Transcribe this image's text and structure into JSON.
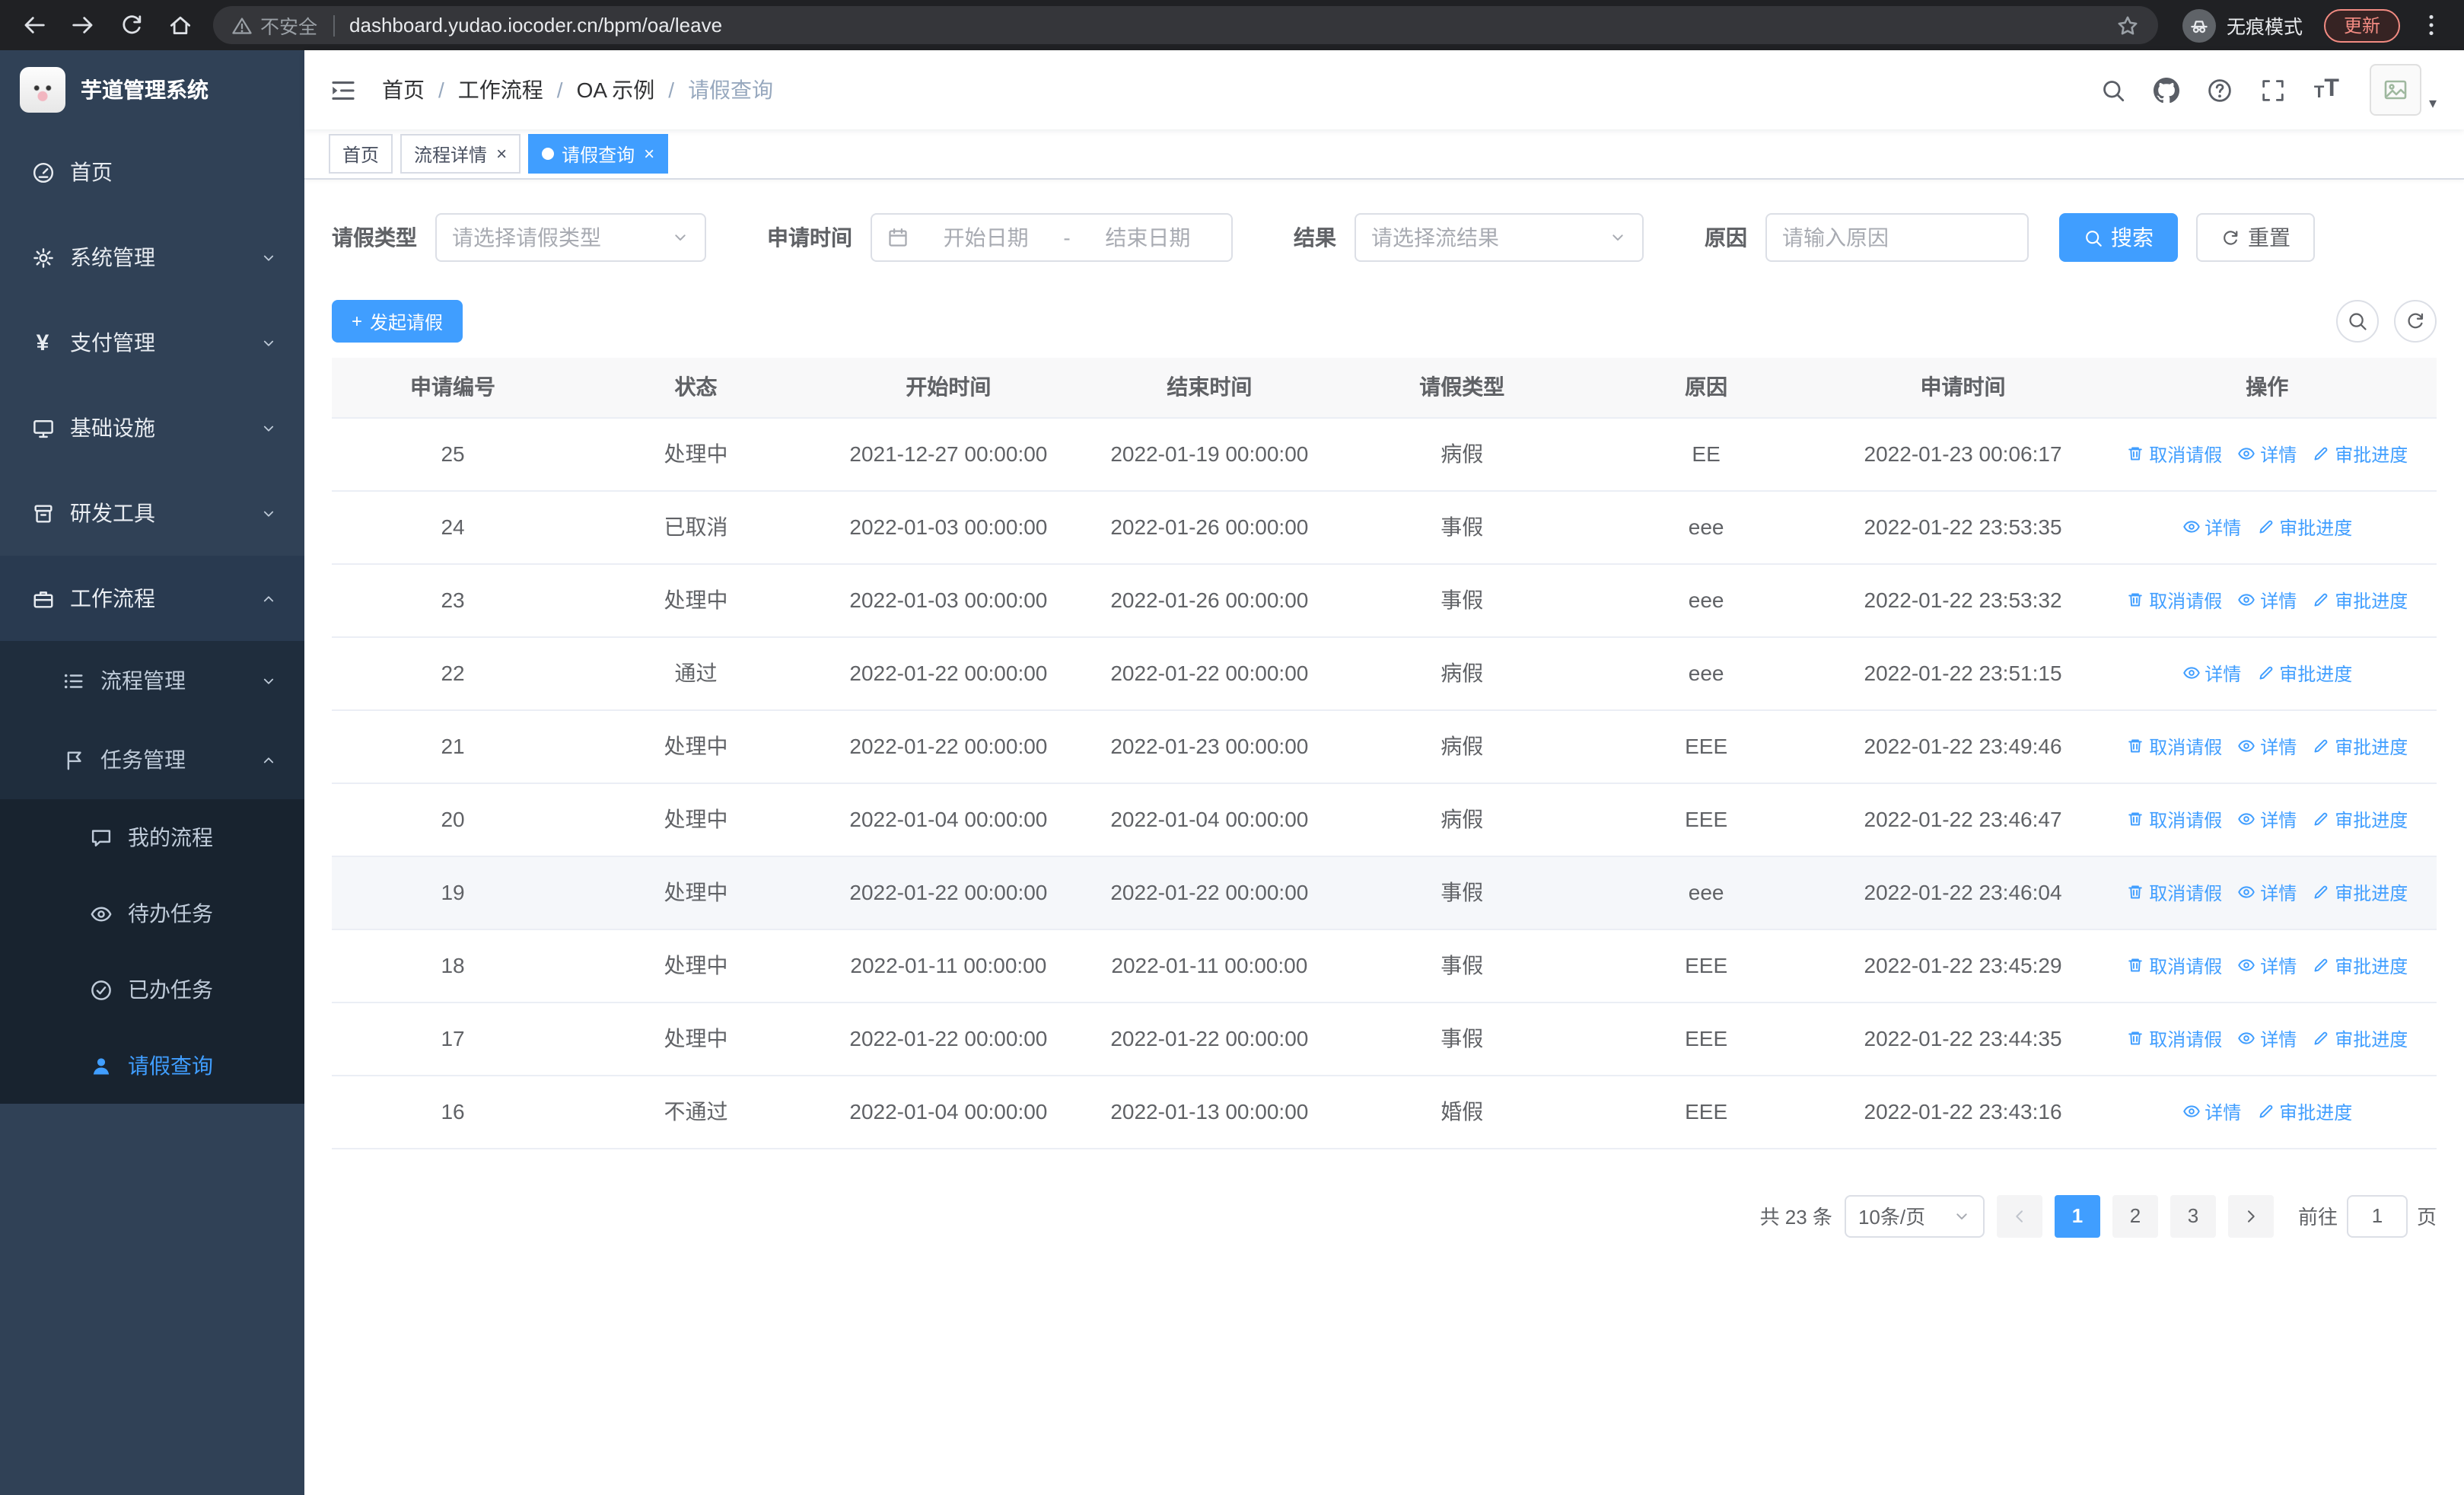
{
  "colors": {
    "accent": "#409eff",
    "sidebar_bg": "#304156",
    "sidebar_sub_bg": "#1f2d3d",
    "sidebar_sub2_bg": "#18232f",
    "browser_bar_bg": "#202124",
    "table_header_bg": "#f8f8f9"
  },
  "browser": {
    "nav_icons": [
      "back-icon",
      "forward-icon",
      "reload-icon",
      "home-icon"
    ],
    "security_warning": "不安全",
    "url": "dashboard.yudao.iocoder.cn/bpm/oa/leave",
    "incognito_label": "无痕模式",
    "update_button": "更新"
  },
  "sidebar": {
    "logo_title": "芋道管理系统",
    "menu": [
      {
        "key": "home",
        "label": "首页",
        "icon": "dashboard-icon",
        "level": 1
      },
      {
        "key": "system",
        "label": "系统管理",
        "icon": "gear-icon",
        "level": 1,
        "chevron": "down"
      },
      {
        "key": "payment",
        "label": "支付管理",
        "icon": "yen-icon",
        "level": 1,
        "chevron": "down"
      },
      {
        "key": "infra",
        "label": "基础设施",
        "icon": "monitor-icon",
        "level": 1,
        "chevron": "down"
      },
      {
        "key": "devtools",
        "label": "研发工具",
        "icon": "toolbox-icon",
        "level": 1,
        "chevron": "down"
      },
      {
        "key": "workflow",
        "label": "工作流程",
        "icon": "briefcase-icon",
        "level": 1,
        "chevron": "up",
        "expanded": true
      },
      {
        "key": "process-mgmt",
        "label": "流程管理",
        "icon": "list-icon",
        "level": 2,
        "chevron": "down"
      },
      {
        "key": "task-mgmt",
        "label": "任务管理",
        "icon": "flag-icon",
        "level": 2,
        "chevron": "up",
        "expanded": true
      },
      {
        "key": "my-process",
        "label": "我的流程",
        "icon": "chat-icon",
        "level": 3
      },
      {
        "key": "todo-tasks",
        "label": "待办任务",
        "icon": "eye-icon",
        "level": 3
      },
      {
        "key": "done-tasks",
        "label": "已办任务",
        "icon": "check-icon",
        "level": 3
      },
      {
        "key": "leave-query",
        "label": "请假查询",
        "icon": "user-icon",
        "level": 3,
        "active": true
      }
    ]
  },
  "header": {
    "breadcrumb": [
      "首页",
      "工作流程",
      "OA 示例",
      "请假查询"
    ],
    "right_icons": [
      "search-icon",
      "github-icon",
      "help-icon",
      "fullscreen-icon",
      "font-size-icon"
    ]
  },
  "tabs": [
    {
      "label": "首页",
      "closable": false,
      "active": false
    },
    {
      "label": "流程详情",
      "closable": true,
      "active": false
    },
    {
      "label": "请假查询",
      "closable": true,
      "active": true
    }
  ],
  "filters": {
    "leave_type_label": "请假类型",
    "leave_type_placeholder": "请选择请假类型",
    "apply_time_label": "申请时间",
    "start_date_placeholder": "开始日期",
    "range_separator": "-",
    "end_date_placeholder": "结束日期",
    "result_label": "结果",
    "result_placeholder": "请选择流结果",
    "reason_label": "原因",
    "reason_placeholder": "请输入原因",
    "search_button": "搜索",
    "reset_button": "重置"
  },
  "toolbar": {
    "create_button": "发起请假"
  },
  "table": {
    "columns": [
      "申请编号",
      "状态",
      "开始时间",
      "结束时间",
      "请假类型",
      "原因",
      "申请时间",
      "操作"
    ],
    "action_labels": {
      "cancel": "取消请假",
      "detail": "详情",
      "progress": "审批进度"
    },
    "action_icons": {
      "cancel": "delete-icon",
      "detail": "view-icon",
      "progress": "edit-icon"
    },
    "hovered_row": "19",
    "rows": [
      {
        "id": "25",
        "status": "处理中",
        "start": "2021-12-27 00:00:00",
        "end": "2022-01-19 00:00:00",
        "type": "病假",
        "reason": "EE",
        "applied": "2022-01-23 00:06:17",
        "actions": [
          "cancel",
          "detail",
          "progress"
        ]
      },
      {
        "id": "24",
        "status": "已取消",
        "start": "2022-01-03 00:00:00",
        "end": "2022-01-26 00:00:00",
        "type": "事假",
        "reason": "eee",
        "applied": "2022-01-22 23:53:35",
        "actions": [
          "detail",
          "progress"
        ]
      },
      {
        "id": "23",
        "status": "处理中",
        "start": "2022-01-03 00:00:00",
        "end": "2022-01-26 00:00:00",
        "type": "事假",
        "reason": "eee",
        "applied": "2022-01-22 23:53:32",
        "actions": [
          "cancel",
          "detail",
          "progress"
        ]
      },
      {
        "id": "22",
        "status": "通过",
        "start": "2022-01-22 00:00:00",
        "end": "2022-01-22 00:00:00",
        "type": "病假",
        "reason": "eee",
        "applied": "2022-01-22 23:51:15",
        "actions": [
          "detail",
          "progress"
        ]
      },
      {
        "id": "21",
        "status": "处理中",
        "start": "2022-01-22 00:00:00",
        "end": "2022-01-23 00:00:00",
        "type": "病假",
        "reason": "EEE",
        "applied": "2022-01-22 23:49:46",
        "actions": [
          "cancel",
          "detail",
          "progress"
        ]
      },
      {
        "id": "20",
        "status": "处理中",
        "start": "2022-01-04 00:00:00",
        "end": "2022-01-04 00:00:00",
        "type": "病假",
        "reason": "EEE",
        "applied": "2022-01-22 23:46:47",
        "actions": [
          "cancel",
          "detail",
          "progress"
        ]
      },
      {
        "id": "19",
        "status": "处理中",
        "start": "2022-01-22 00:00:00",
        "end": "2022-01-22 00:00:00",
        "type": "事假",
        "reason": "eee",
        "applied": "2022-01-22 23:46:04",
        "actions": [
          "cancel",
          "detail",
          "progress"
        ]
      },
      {
        "id": "18",
        "status": "处理中",
        "start": "2022-01-11 00:00:00",
        "end": "2022-01-11 00:00:00",
        "type": "事假",
        "reason": "EEE",
        "applied": "2022-01-22 23:45:29",
        "actions": [
          "cancel",
          "detail",
          "progress"
        ]
      },
      {
        "id": "17",
        "status": "处理中",
        "start": "2022-01-22 00:00:00",
        "end": "2022-01-22 00:00:00",
        "type": "事假",
        "reason": "EEE",
        "applied": "2022-01-22 23:44:35",
        "actions": [
          "cancel",
          "detail",
          "progress"
        ]
      },
      {
        "id": "16",
        "status": "不通过",
        "start": "2022-01-04 00:00:00",
        "end": "2022-01-13 00:00:00",
        "type": "婚假",
        "reason": "EEE",
        "applied": "2022-01-22 23:43:16",
        "actions": [
          "detail",
          "progress"
        ]
      }
    ]
  },
  "pagination": {
    "total_text": "共 23 条",
    "page_size": "10条/页",
    "pages": [
      "1",
      "2",
      "3"
    ],
    "active_page": "1",
    "goto_prefix": "前往",
    "goto_value": "1",
    "goto_suffix": "页"
  }
}
